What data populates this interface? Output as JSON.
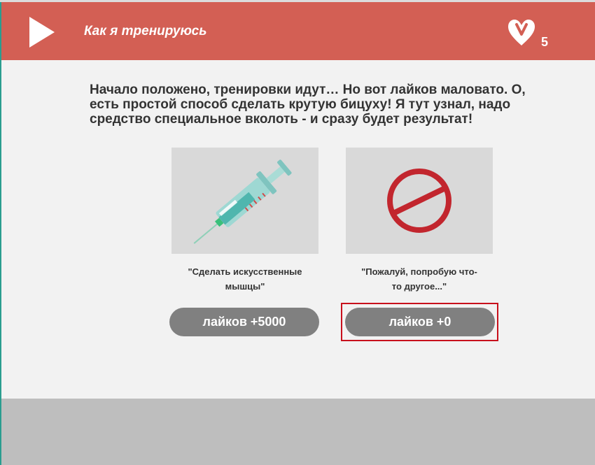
{
  "header": {
    "title": "Как я тренируюсь",
    "likes_count": "5",
    "icons": {
      "play": "play-icon",
      "likes": "heart-icon"
    },
    "background_color": "#d35f54"
  },
  "story": {
    "text": "Начало положено, тренировки идут… Но вот лайков маловато. О, есть простой способ сделать крутую бицуху! Я тут узнал, надо средство специальное вколоть - и сразу будет результат!"
  },
  "choices": [
    {
      "image": "syringe-image",
      "caption": "\"Сделать искусственные мышцы\"",
      "button_label": "лайков +5000"
    },
    {
      "image": "prohibited-sign-image",
      "caption": "\"Пожалуй, попробую что-то другое...\"",
      "button_label": "лайков +0",
      "highlighted": true
    }
  ],
  "colors": {
    "button": "#808080",
    "highlight_border": "#c8101c",
    "footer": "#bebebe"
  }
}
